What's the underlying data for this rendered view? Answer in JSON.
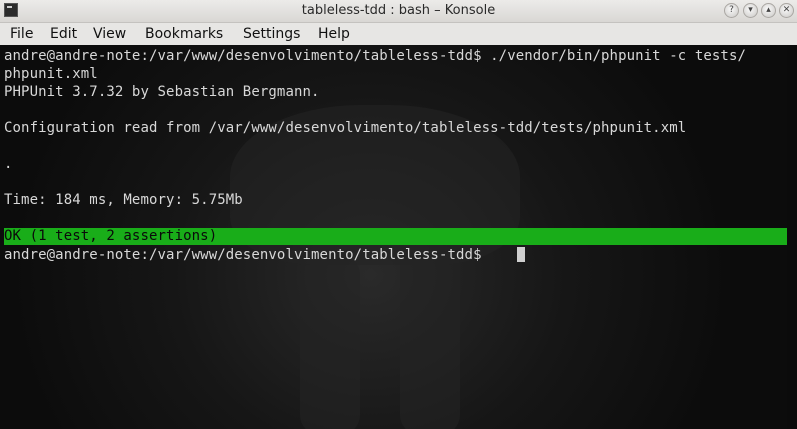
{
  "window": {
    "title": "tableless-tdd : bash – Konsole"
  },
  "titlebar_buttons": [
    {
      "icon": "help-icon",
      "glyph": "?"
    },
    {
      "icon": "minimize-icon",
      "glyph": "▾"
    },
    {
      "icon": "maximize-icon",
      "glyph": "▴"
    },
    {
      "icon": "close-icon",
      "glyph": "✕"
    }
  ],
  "menu": [
    "File",
    "Edit",
    "View",
    "Bookmarks",
    "Settings",
    "Help"
  ],
  "terminal": {
    "lines": [
      "andre@andre-note:/var/www/desenvolvimento/tableless-tdd$ ./vendor/bin/phpunit -c tests/",
      "phpunit.xml",
      "PHPUnit 3.7.32 by Sebastian Bergmann.",
      "",
      "Configuration read from /var/www/desenvolvimento/tableless-tdd/tests/phpunit.xml",
      "",
      ".",
      "",
      "Time: 184 ms, Memory: 5.75Mb",
      ""
    ],
    "ok_line": "OK (1 test, 2 assertions)",
    "prompt": "andre@andre-note:/var/www/desenvolvimento/tableless-tdd$ "
  },
  "colors": {
    "ok_bar": "#19ad19",
    "background": "#111111",
    "text": "#d8d8d8"
  }
}
